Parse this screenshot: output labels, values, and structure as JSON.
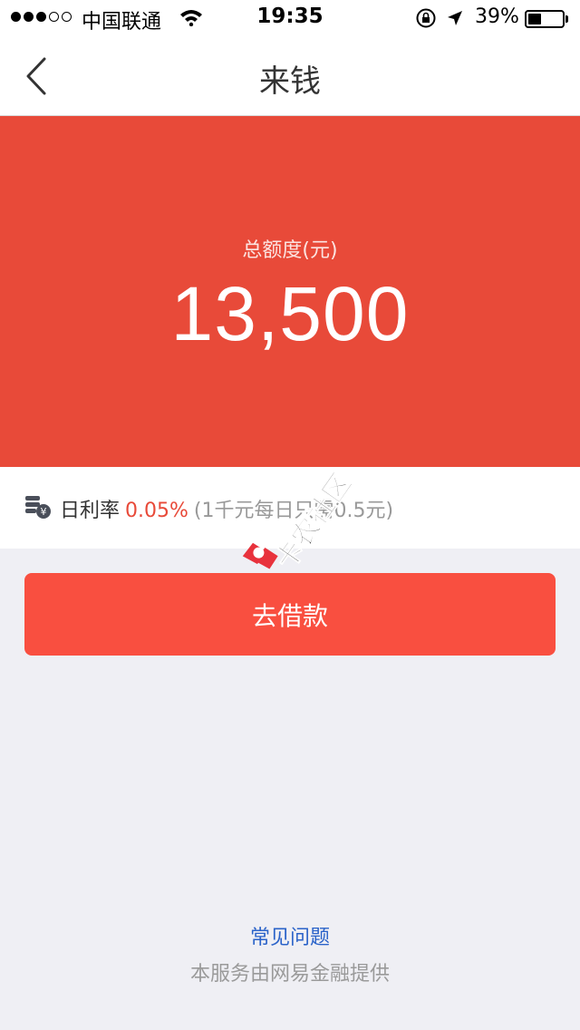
{
  "status_bar": {
    "signal_full": 3,
    "signal_empty": 2,
    "carrier": "中国联通",
    "time": "19:35",
    "battery_percent_text": "39%",
    "battery_level": 0.39
  },
  "nav": {
    "title": "来钱",
    "back_icon": "chevron-left-icon"
  },
  "credit": {
    "label": "总额度(元)",
    "amount": "13,500",
    "background_color": "#e84a39"
  },
  "rate": {
    "icon": "coins-yuan-icon",
    "label": "日利率",
    "value": "0.05%",
    "note": "(1千元每日只需0.5元)"
  },
  "actions": {
    "borrow_label": "去借款",
    "borrow_color": "#f94f40"
  },
  "footer": {
    "faq_label": "常见问题",
    "provider_text": "本服务由网易金融提供"
  },
  "watermark": {
    "text": "卡农社区"
  }
}
